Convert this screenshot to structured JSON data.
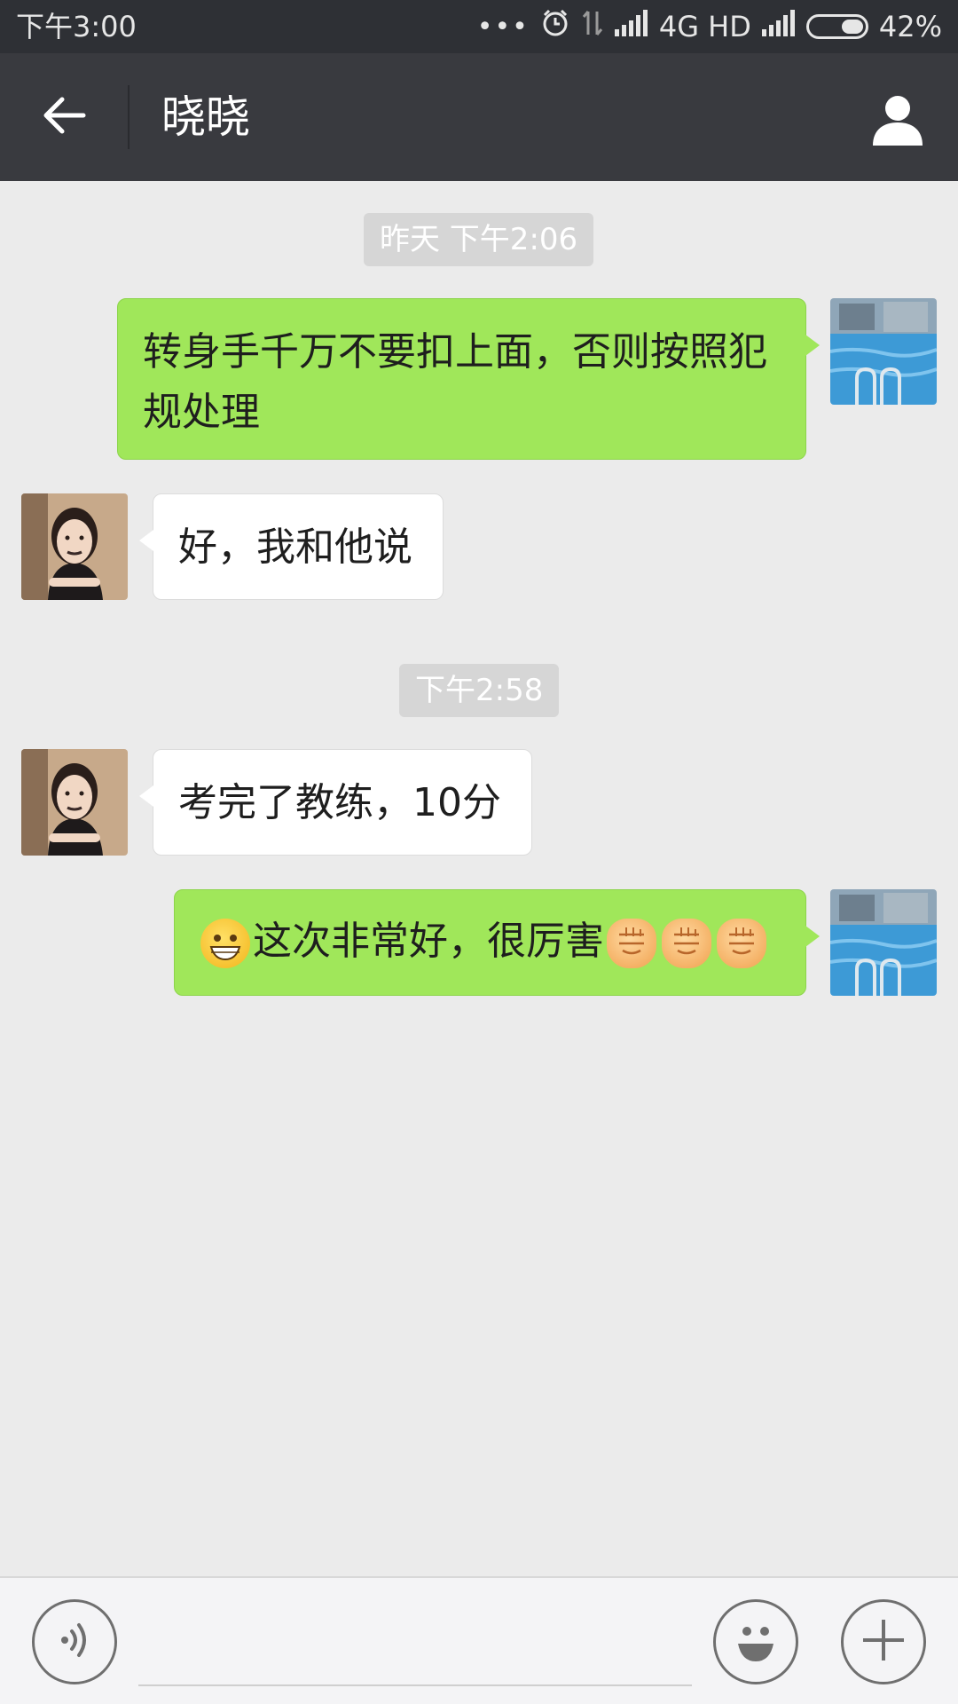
{
  "status_bar": {
    "time": "下午3:00",
    "dots": "•••",
    "network": "4G HD",
    "battery": "42%",
    "battery_level": 0.42,
    "icons": [
      "alarm-icon",
      "data-arrows-icon",
      "signal-icon",
      "battery-icon"
    ]
  },
  "header": {
    "title": "晓晓",
    "back_icon": "arrow-left-icon",
    "profile_icon": "person-icon"
  },
  "chat": {
    "timestamps": [
      "昨天 下午2:06",
      "下午2:58"
    ],
    "messages": [
      {
        "sender": "me",
        "text": "转身手千万不要扣上面，否则按照犯规处理"
      },
      {
        "sender": "other",
        "text": "好，我和他说"
      },
      {
        "sender": "other",
        "text": "考完了教练，10分"
      },
      {
        "sender": "me",
        "text": "这次非常好，很厉害",
        "emoji": [
          "grin-icon",
          "fist-icon",
          "fist-icon",
          "fist-icon"
        ]
      }
    ]
  },
  "input_bar": {
    "voice_icon": "voice-icon",
    "emoji_icon": "smiley-icon",
    "plus_icon": "plus-icon",
    "text_value": ""
  },
  "colors": {
    "title_bar": "#393a3f",
    "status_bar": "#2e3035",
    "my_bubble": "#a0e75a",
    "their_bubble": "#ffffff",
    "chat_bg": "#ebebeb"
  }
}
